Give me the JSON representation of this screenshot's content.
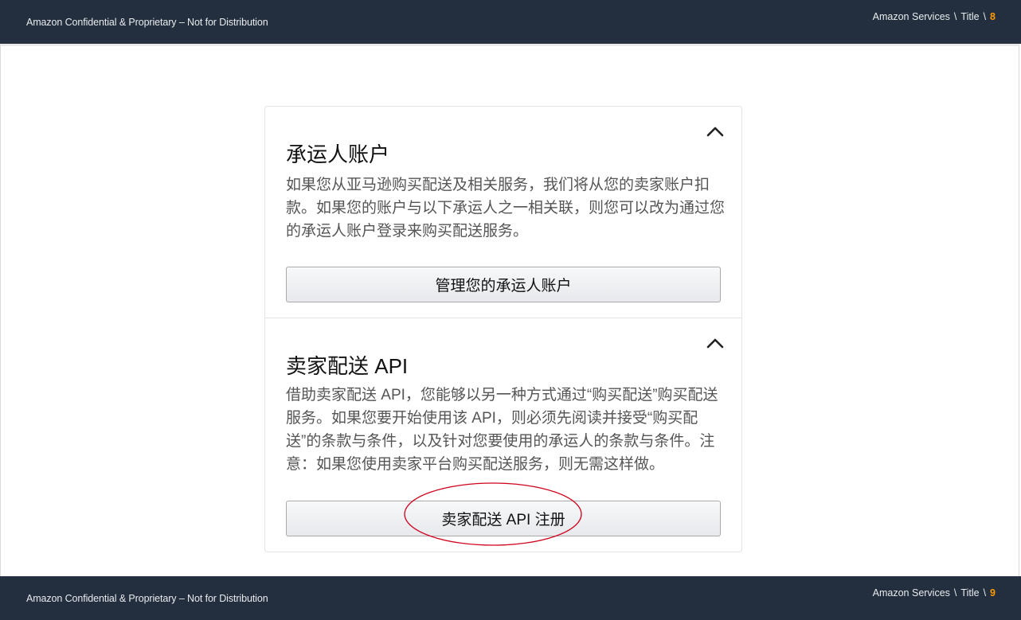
{
  "header": {
    "confidential": "Amazon Confidential & Proprietary – Not for Distribution",
    "crumb_company": "Amazon Services",
    "crumb_sep": "\\",
    "crumb_title": "Title",
    "page_number": "8"
  },
  "footer": {
    "confidential": "Amazon Confidential & Proprietary – Not for Distribution",
    "crumb_company": "Amazon Services",
    "crumb_sep": "\\",
    "crumb_title": "Title",
    "page_number": "9"
  },
  "carrier_section": {
    "title": "承运人账户",
    "description": "如果您从亚马逊购买配送及相关服务，我们将从您的卖家账户扣款。如果您的账户与以下承运人之一相关联，则您可以改为通过您的承运人账户登录来购买配送服务。",
    "button_label": "管理您的承运人账户",
    "toggle_icon": "chevron-up-icon"
  },
  "api_section": {
    "title": "卖家配送 API",
    "description": "借助卖家配送 API，您能够以另一种方式通过“购买配送”购买配送服务。如果您要开始使用该 API，则必须先阅读并接受“购买配送”的条款与条件，以及针对您要使用的承运人的条款与条件。注意：如果您使用卖家平台购买配送服务，则无需这样做。",
    "button_label": "卖家配送 API 注册",
    "toggle_icon": "chevron-up-icon"
  },
  "colors": {
    "bar_background": "#232f3e",
    "page_number": "#ff9900",
    "annotation": "#d0021b"
  }
}
